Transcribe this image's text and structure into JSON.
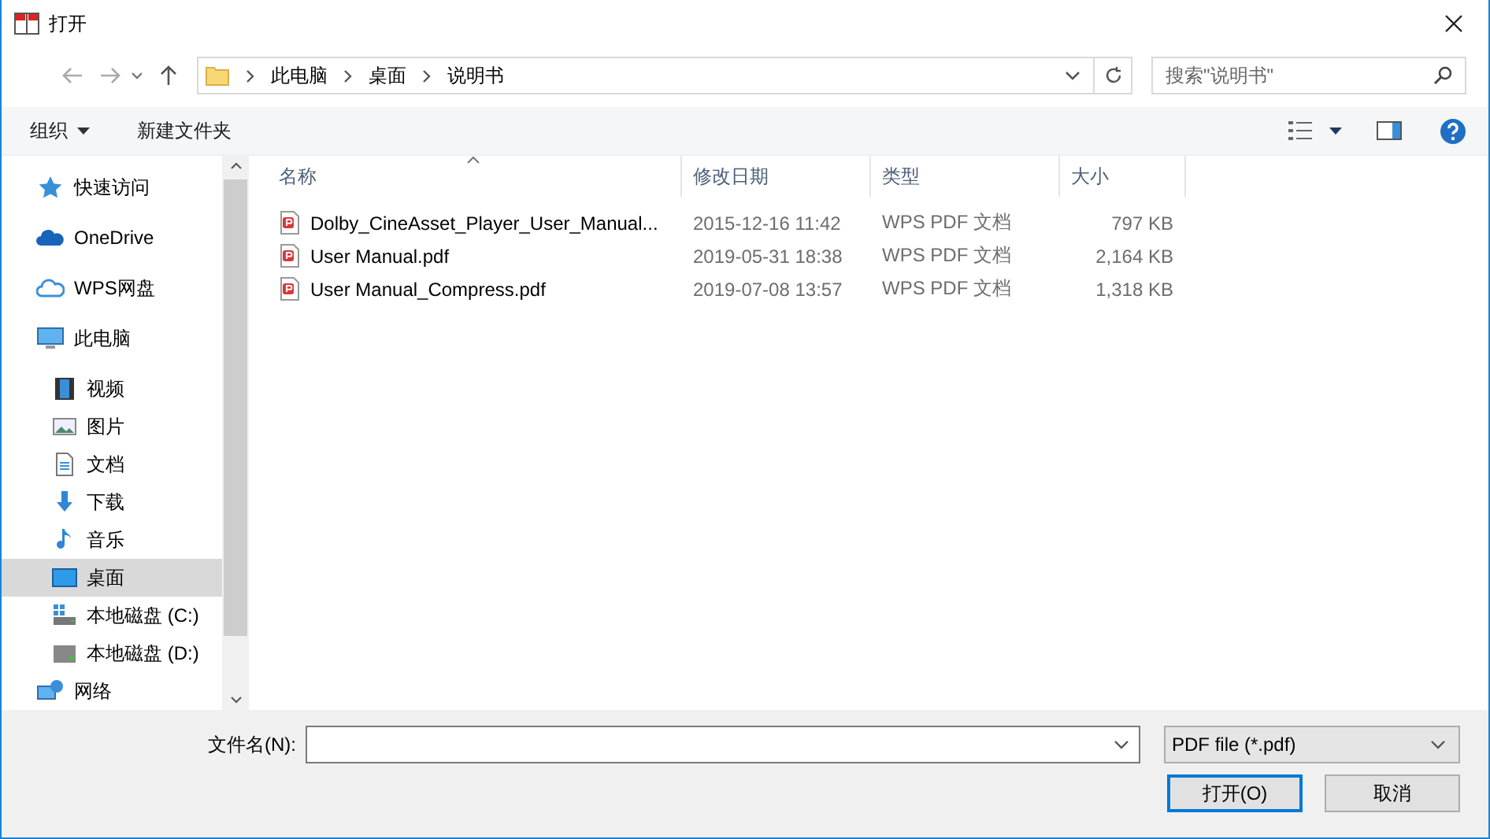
{
  "window": {
    "title": "打开"
  },
  "address": {
    "breadcrumbs": [
      "此电脑",
      "桌面",
      "说明书"
    ]
  },
  "search": {
    "placeholder": "搜索\"说明书\""
  },
  "toolbar": {
    "organize": "组织",
    "new_folder": "新建文件夹"
  },
  "sidebar": {
    "items": [
      {
        "label": "快速访问",
        "kind": "star",
        "selected": false
      },
      {
        "label": "OneDrive",
        "kind": "cloud",
        "selected": false
      },
      {
        "label": "WPS网盘",
        "kind": "cloud-outline",
        "selected": false
      },
      {
        "label": "此电脑",
        "kind": "monitor",
        "selected": false,
        "children": [
          {
            "label": "视频",
            "kind": "film",
            "selected": false
          },
          {
            "label": "图片",
            "kind": "image",
            "selected": false
          },
          {
            "label": "文档",
            "kind": "document",
            "selected": false
          },
          {
            "label": "下载",
            "kind": "download",
            "selected": false
          },
          {
            "label": "音乐",
            "kind": "music",
            "selected": false
          },
          {
            "label": "桌面",
            "kind": "desktop",
            "selected": true
          },
          {
            "label": "本地磁盘 (C:)",
            "kind": "drive-system",
            "selected": false
          },
          {
            "label": "本地磁盘 (D:)",
            "kind": "drive",
            "selected": false
          }
        ]
      },
      {
        "label": "网络",
        "kind": "network",
        "selected": false
      }
    ]
  },
  "table": {
    "columns": [
      {
        "label": "名称",
        "sorted": true
      },
      {
        "label": "修改日期",
        "sorted": false
      },
      {
        "label": "类型",
        "sorted": false
      },
      {
        "label": "大小",
        "sorted": false
      }
    ],
    "rows": [
      {
        "name": "Dolby_CineAsset_Player_User_Manual...",
        "date": "2015-12-16 11:42",
        "type": "WPS PDF 文档",
        "size": "797 KB"
      },
      {
        "name": "User Manual.pdf",
        "date": "2019-05-31 18:38",
        "type": "WPS PDF 文档",
        "size": "2,164 KB"
      },
      {
        "name": "User Manual_Compress.pdf",
        "date": "2019-07-08 13:57",
        "type": "WPS PDF 文档",
        "size": "1,318 KB"
      }
    ]
  },
  "footer": {
    "filename_label": "文件名(N):",
    "filter": "PDF file (*.pdf)",
    "buttons": [
      {
        "label": "打开(O)",
        "default": true
      },
      {
        "label": "取消",
        "default": false
      }
    ]
  }
}
